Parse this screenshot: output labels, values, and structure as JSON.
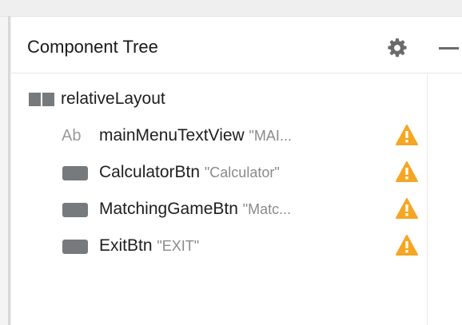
{
  "panel": {
    "title": "Component Tree"
  },
  "icons": {
    "settings": "gear-icon",
    "minimize": "minimize-icon",
    "warning": "warning-icon",
    "layout": "relative-layout-icon",
    "textview": "textview-icon",
    "button": "button-icon"
  },
  "colors": {
    "warning": "#f5a623",
    "icon_gray": "#777a7d",
    "hint_gray": "#8a8a8a"
  },
  "tree": {
    "root": {
      "label": "relativeLayout"
    },
    "children": [
      {
        "label": "mainMenuTextView",
        "hint": "\"MAI...",
        "type": "textview",
        "warning": true
      },
      {
        "label": "CalculatorBtn",
        "hint": "\"Calculator\"",
        "type": "button",
        "warning": true
      },
      {
        "label": "MatchingGameBtn",
        "hint": "\"Matc...",
        "type": "button",
        "warning": true
      },
      {
        "label": "ExitBtn",
        "hint": "\"EXIT\"",
        "type": "button",
        "warning": true
      }
    ]
  }
}
